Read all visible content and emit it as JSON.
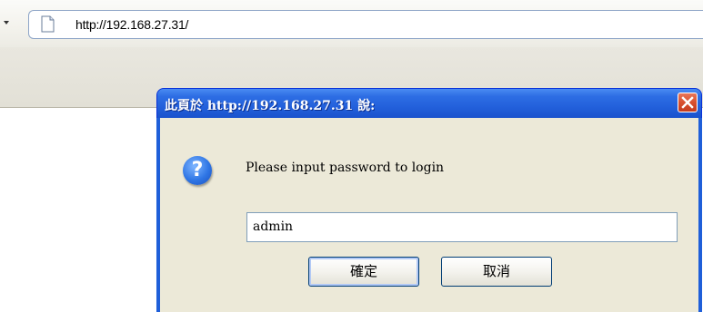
{
  "browser": {
    "url": "http://192.168.27.31/"
  },
  "dialog": {
    "title": "此頁於 http://192.168.27.31 說:",
    "message": "Please input password to login",
    "input_value": "admin",
    "ok_label": "確定",
    "cancel_label": "取消"
  },
  "colors": {
    "titlebar": "#2361dc",
    "dialog_body": "#ece9d8",
    "close_button": "#d8502f"
  }
}
